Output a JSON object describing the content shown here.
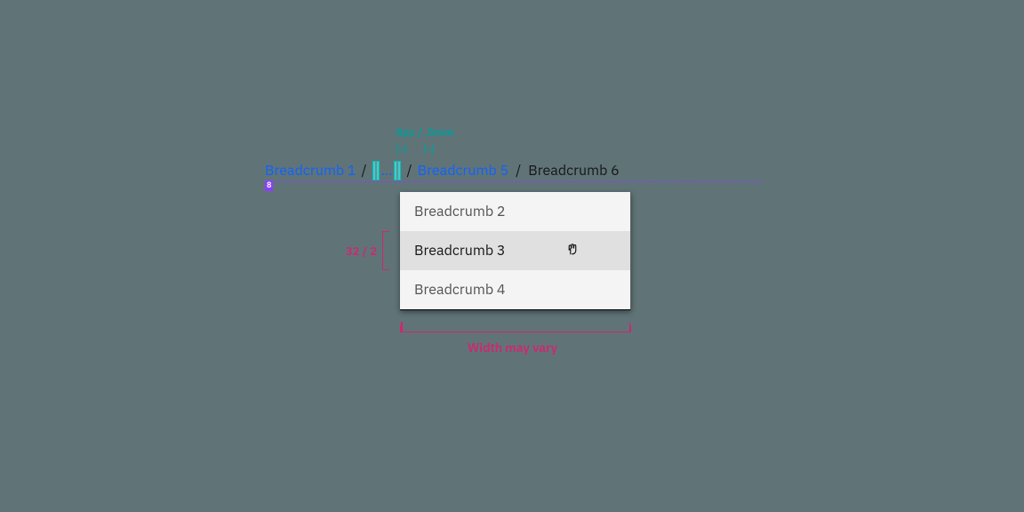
{
  "breadcrumb": {
    "items": [
      {
        "label": "Breadcrumb 1",
        "kind": "link"
      },
      {
        "label": "Breadcrumb 5",
        "kind": "link"
      },
      {
        "label": "Breadcrumb 6",
        "kind": "current"
      }
    ],
    "separator": "/",
    "overflow_glyph": "…",
    "overflow_items": [
      {
        "label": "Breadcrumb 2"
      },
      {
        "label": "Breadcrumb 3"
      },
      {
        "label": "Breadcrumb 4"
      }
    ],
    "hovered_overflow_index": 1
  },
  "annotations": {
    "gap_label": "8px / .5rem",
    "baseline_badge": "8",
    "row_height_label": "32 / 2",
    "width_label": "Width may vary"
  },
  "colors": {
    "link": "#0f62fe",
    "text": "#161616",
    "muted": "#525252",
    "surface": "#f4f4f4",
    "hover": "#e0e0e0",
    "teal": "#009d9a",
    "magenta": "#d02670",
    "purple": "#8a3ffc",
    "canvas": "#607478"
  }
}
